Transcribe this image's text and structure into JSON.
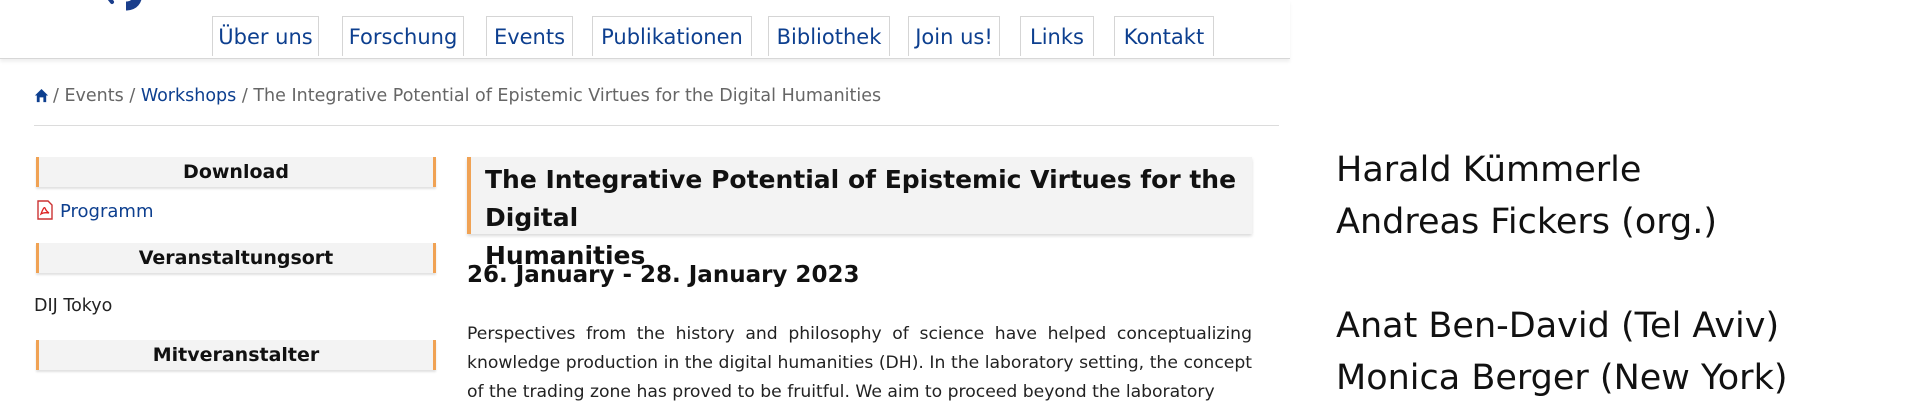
{
  "nav": {
    "items": [
      "Über uns",
      "Forschung",
      "Events",
      "Publikationen",
      "Bibliothek",
      "Join us!",
      "Links",
      "Kontakt"
    ]
  },
  "breadcrumb": {
    "home_icon": "home-icon",
    "sep": "/",
    "events": "Events",
    "workshops": "Workshops",
    "current": "The Integrative Potential of Epistemic Virtues for the Digital Humanities"
  },
  "sidebar": {
    "download_heading": "Download",
    "programm_link": "Programm",
    "pdf_icon": "pdf-icon",
    "venue_heading": "Veranstaltungsort",
    "venue": "DIJ Tokyo",
    "coorganizer_heading": "Mitveranstalter"
  },
  "article": {
    "title_line1": "The Integrative Potential of Epistemic Virtues for the Digital",
    "title_line2": "Humanities",
    "date": "26. January - 28. January 2023",
    "paragraph": "Perspectives from the history and philosophy of science have helped conceptualizing knowledge production in the digital humanities (DH). In the laboratory setting, the concept of the trading zone has proved to be fruitful. We aim to proceed beyond the laboratory"
  },
  "slide": {
    "organizers": [
      "Harald Kümmerle",
      "Andreas Fickers (org.)"
    ],
    "participants": [
      "Anat Ben-David (Tel Aviv)",
      "Monica Berger (New York)"
    ]
  },
  "colors": {
    "link": "#0d3f8f",
    "accent": "#f0a254",
    "logo": "#1a3e8c"
  }
}
